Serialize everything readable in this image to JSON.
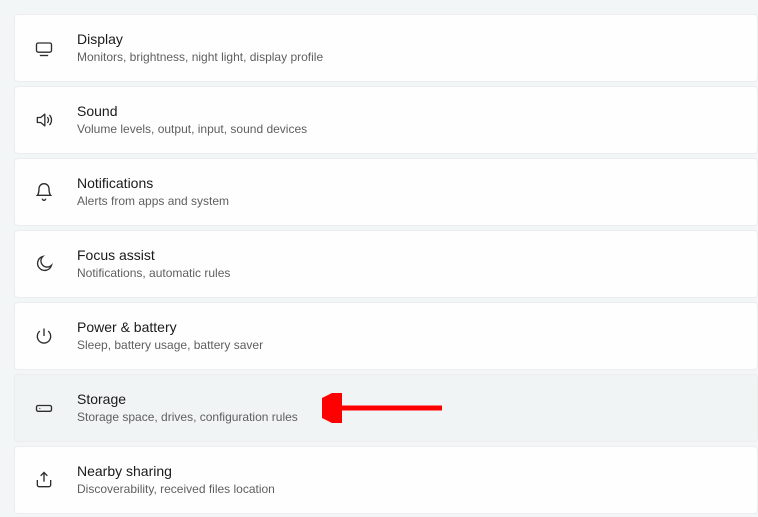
{
  "settings": [
    {
      "key": "display",
      "title": "Display",
      "desc": "Monitors, brightness, night light, display profile",
      "icon": "display-icon"
    },
    {
      "key": "sound",
      "title": "Sound",
      "desc": "Volume levels, output, input, sound devices",
      "icon": "sound-icon"
    },
    {
      "key": "notifications",
      "title": "Notifications",
      "desc": "Alerts from apps and system",
      "icon": "bell-icon"
    },
    {
      "key": "focus",
      "title": "Focus assist",
      "desc": "Notifications, automatic rules",
      "icon": "moon-icon"
    },
    {
      "key": "power",
      "title": "Power & battery",
      "desc": "Sleep, battery usage, battery saver",
      "icon": "power-icon"
    },
    {
      "key": "storage",
      "title": "Storage",
      "desc": "Storage space, drives, configuration rules",
      "icon": "drive-icon",
      "hovered": true
    },
    {
      "key": "nearby",
      "title": "Nearby sharing",
      "desc": "Discoverability, received files location",
      "icon": "share-icon"
    }
  ],
  "annotation": {
    "arrow_color": "#ff0000"
  }
}
